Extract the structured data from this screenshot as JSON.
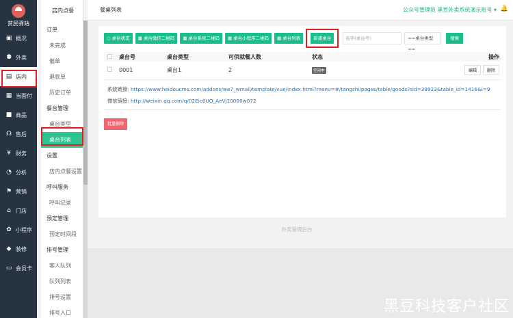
{
  "brand": {
    "name": "贫民驿站"
  },
  "nav1": [
    {
      "label": "概况",
      "icon": "square-icon",
      "glyph": "▣"
    },
    {
      "label": "外卖",
      "icon": "bike-icon",
      "glyph": "⚉"
    },
    {
      "label": "店内",
      "icon": "store-icon",
      "glyph": "▤",
      "active": true
    },
    {
      "label": "当面付",
      "icon": "pay-icon",
      "glyph": "▦"
    },
    {
      "label": "商品",
      "icon": "goods-icon",
      "glyph": "■"
    },
    {
      "label": "售后",
      "icon": "headset-icon",
      "glyph": "☊"
    },
    {
      "label": "财务",
      "icon": "money-icon",
      "glyph": "¥"
    },
    {
      "label": "分析",
      "icon": "chart-icon",
      "glyph": "◔"
    },
    {
      "label": "营销",
      "icon": "flag-icon",
      "glyph": "⚑"
    },
    {
      "label": "门店",
      "icon": "shop-icon",
      "glyph": "⌂"
    },
    {
      "label": "小程序",
      "icon": "miniapp-icon",
      "glyph": "✿"
    },
    {
      "label": "装修",
      "icon": "drop-icon",
      "glyph": "◆"
    },
    {
      "label": "会员卡",
      "icon": "card-icon",
      "glyph": "▭"
    }
  ],
  "nav2": {
    "title": "店内点餐",
    "items": [
      {
        "type": "group",
        "label": "订单"
      },
      {
        "type": "item",
        "label": "未完成"
      },
      {
        "type": "item",
        "label": "催单"
      },
      {
        "type": "item",
        "label": "退款单"
      },
      {
        "type": "item",
        "label": "历史订单"
      },
      {
        "type": "group",
        "label": "餐台管理"
      },
      {
        "type": "item",
        "label": "桌台类型"
      },
      {
        "type": "item",
        "label": "桌台列表",
        "active": true
      },
      {
        "type": "group",
        "label": "设置"
      },
      {
        "type": "item",
        "label": "店内点餐设置"
      },
      {
        "type": "group",
        "label": "呼叫服务"
      },
      {
        "type": "item",
        "label": "呼叫记录"
      },
      {
        "type": "group",
        "label": "预定管理"
      },
      {
        "type": "item",
        "label": "预定时间段"
      },
      {
        "type": "group",
        "label": "排号管理"
      },
      {
        "type": "item",
        "label": "客人队列"
      },
      {
        "type": "item",
        "label": "队列列表"
      },
      {
        "type": "item",
        "label": "排号设置"
      },
      {
        "type": "item",
        "label": "排号入口"
      }
    ]
  },
  "topbar": {
    "title": "餐桌列表",
    "account": "公众号管理员 黑豆外卖系统演示账号",
    "account_caret": "▾",
    "bell": "🔔"
  },
  "toolbar": {
    "buttons": [
      {
        "label": "桌台状态",
        "icon": "circle-icon",
        "glyph": "○"
      },
      {
        "label": "桌台微信二维码",
        "icon": "qrcode-icon",
        "glyph": "▦"
      },
      {
        "label": "桌台系统二维码",
        "icon": "qrcode-icon",
        "glyph": "▦"
      },
      {
        "label": "桌台小程序二维码",
        "icon": "qrcode-icon",
        "glyph": "▦"
      },
      {
        "label": "桌台列表",
        "icon": "list-icon",
        "glyph": "▦"
      }
    ],
    "new_label": "新建桌台",
    "search_placeholder": "名字(桌台号)",
    "select_value": "==桌台类型==",
    "search_label": "搜索"
  },
  "table": {
    "headers": [
      "桌台号",
      "桌台类型",
      "可供就餐人数",
      "状态",
      "操作"
    ],
    "rows": [
      {
        "no": "0001",
        "type": "桌台1",
        "people": "2",
        "status": "空闲中",
        "edit": "编辑",
        "delete": "删除"
      }
    ]
  },
  "links": {
    "system_label": "系统链接:",
    "system_url": "https://www.heidoucms.com/addons/we7_wmall/template/vue/index.html?menu=#/tangshi/pages/table/goods?sid=39923&table_id=1416&i=9",
    "wechat_label": "微信链接:",
    "wechat_url": "http://weixin.qq.com/q/02Eic6UO_AeVj10000w072"
  },
  "batch_delete": "批量删除",
  "footer": "外卖管理后台",
  "watermark": "黑豆科技客户社区",
  "colors": {
    "accent": "#19be8a",
    "danger": "#f0646f",
    "sidebar": "#263442",
    "highlight": "#e02020"
  }
}
